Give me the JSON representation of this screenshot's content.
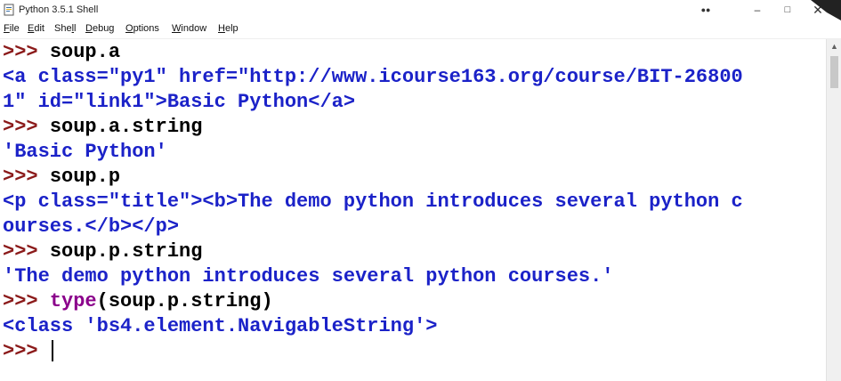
{
  "window": {
    "title": "Python 3.5.1 Shell"
  },
  "menu": [
    {
      "label": "File",
      "u": "F",
      "rest": "ile"
    },
    {
      "label": "Edit",
      "u": "E",
      "rest": "dit"
    },
    {
      "label": "Shell",
      "pre": "She",
      "u": "l",
      "rest": "l"
    },
    {
      "label": "Debug",
      "u": "D",
      "rest": "ebug"
    },
    {
      "label": "Options",
      "u": "O",
      "rest": "ptions"
    },
    {
      "label": "Window",
      "u": "W",
      "rest": "indow"
    },
    {
      "label": "Help",
      "u": "H",
      "rest": "elp"
    }
  ],
  "shell": {
    "prompt": ">>> ",
    "lines": [
      {
        "prompt": ">>> ",
        "text": "soup.a"
      },
      {
        "text": "<a class=\"py1\" href=\"http://www.icourse163.org/course/BIT-26800"
      },
      {
        "text": "1\" id=\"link1\">Basic Python</a>"
      },
      {
        "prompt": ">>> ",
        "text": "soup.a.string"
      },
      {
        "text": "'Basic Python'"
      },
      {
        "prompt": ">>> ",
        "text": "soup.p"
      },
      {
        "text": "<p class=\"title\"><b>The demo python introduces several python c"
      },
      {
        "text": "ourses.</b></p>"
      },
      {
        "prompt": ">>> ",
        "text": "soup.p.string"
      },
      {
        "text": "'The demo python introduces several python courses.'"
      },
      {
        "prompt": ">>> ",
        "builtin": "type",
        "text": "(soup.p.string)"
      },
      {
        "text": "<class 'bs4.element.NavigableString'>"
      },
      {
        "prompt": ">>> ",
        "text": ""
      }
    ]
  },
  "colors": {
    "prompt": "#8b1a1a",
    "input": "#000000",
    "output": "#1b22c8",
    "builtin": "#8b008b"
  }
}
